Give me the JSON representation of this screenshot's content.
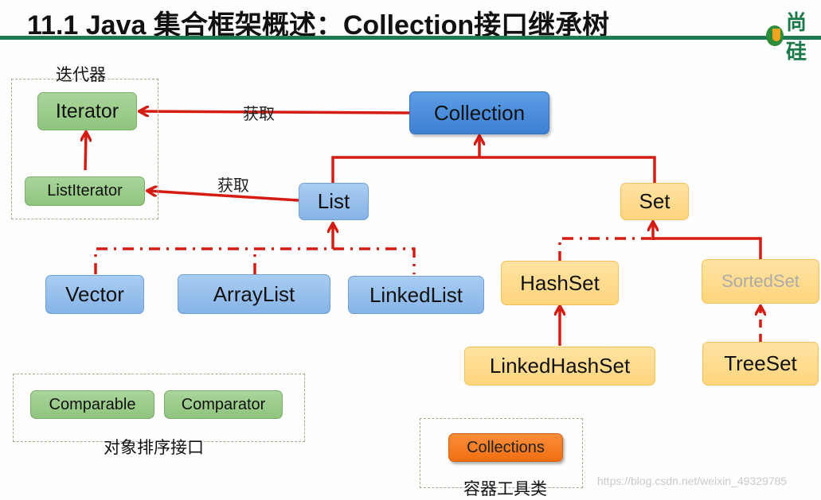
{
  "header": {
    "title": "11.1 Java 集合框架概述：Collection接口继承树",
    "logo_text": "尚硅",
    "accent_color": "#1d7a52"
  },
  "groups": {
    "iterator_group": "迭代器",
    "sorting_group": "对象排序接口",
    "utility_group": "容器工具类"
  },
  "nodes": {
    "iterator": "Iterator",
    "list_iterator": "ListIterator",
    "collection": "Collection",
    "list": "List",
    "set": "Set",
    "vector": "Vector",
    "array_list": "ArrayList",
    "linked_list": "LinkedList",
    "hash_set": "HashSet",
    "sorted_set": "SortedSet",
    "linked_hash_set": "LinkedHashSet",
    "tree_set": "TreeSet",
    "comparable": "Comparable",
    "comparator": "Comparator",
    "collections": "Collections"
  },
  "edge_labels": {
    "collection_to_iterator": "获取",
    "list_to_list_iterator": "获取"
  },
  "edges": [
    {
      "from": "Collection",
      "to": "Iterator",
      "style": "solid",
      "label": "获取"
    },
    {
      "from": "List",
      "to": "ListIterator",
      "style": "solid",
      "label": "获取"
    },
    {
      "from": "ListIterator",
      "to": "Iterator",
      "style": "solid"
    },
    {
      "from": "List",
      "to": "Collection",
      "style": "solid"
    },
    {
      "from": "Set",
      "to": "Collection",
      "style": "solid"
    },
    {
      "from": "Vector",
      "to": "List",
      "style": "dash-dot"
    },
    {
      "from": "ArrayList",
      "to": "List",
      "style": "dash-dot"
    },
    {
      "from": "LinkedList",
      "to": "List",
      "style": "dash-dot"
    },
    {
      "from": "HashSet",
      "to": "Set",
      "style": "dash-dot"
    },
    {
      "from": "SortedSet",
      "to": "Set",
      "style": "solid"
    },
    {
      "from": "LinkedHashSet",
      "to": "HashSet",
      "style": "solid"
    },
    {
      "from": "TreeSet",
      "to": "SortedSet",
      "style": "dashed"
    }
  ],
  "colors": {
    "interface_green": "#9ccc8a",
    "list_blue": "#93bdeb",
    "collection_blue": "#4a8ddc",
    "set_yellow": "#ffdb8c",
    "utility_orange": "#f37a22",
    "edge_red": "#d41c12"
  },
  "watermark": "https://blog.csdn.net/weixin_49329785"
}
